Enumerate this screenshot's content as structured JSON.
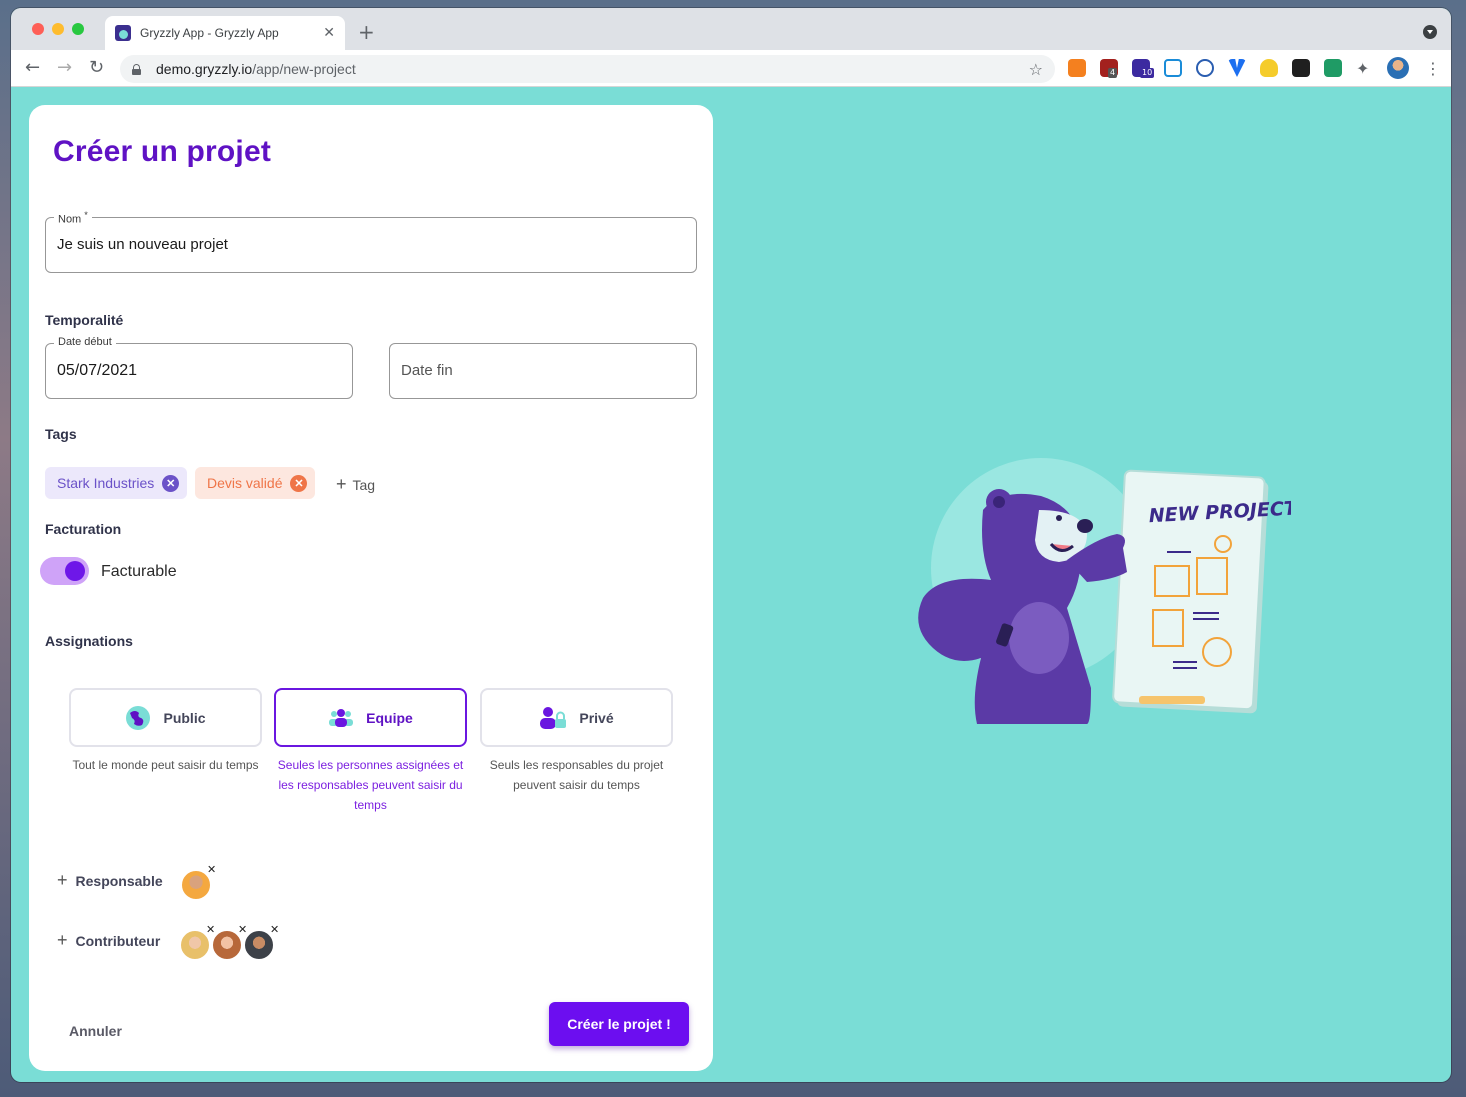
{
  "browser": {
    "tab_title": "Gryzzly App - Gryzzly App",
    "url_host": "demo.gryzzly.io",
    "url_path": "/app/new-project",
    "extension_badges": [
      "4",
      "10"
    ]
  },
  "form": {
    "title": "Créer un projet",
    "name": {
      "label": "Nom",
      "required_mark": "*",
      "value": "Je suis un nouveau projet"
    },
    "temporality": {
      "heading": "Temporalité",
      "start": {
        "label": "Date début",
        "value": "05/07/2021"
      },
      "end": {
        "placeholder": "Date fin"
      }
    },
    "tags": {
      "heading": "Tags",
      "items": [
        {
          "label": "Stark Industries",
          "color": "#6b52c8"
        },
        {
          "label": "Devis validé",
          "color": "#ef7548"
        }
      ],
      "add_label": "Tag"
    },
    "billing": {
      "heading": "Facturation",
      "toggle_label": "Facturable",
      "enabled": true
    },
    "assignations": {
      "heading": "Assignations",
      "options": [
        {
          "label": "Public",
          "icon": "globe-icon",
          "description": "Tout le monde peut saisir du temps",
          "selected": false
        },
        {
          "label": "Equipe",
          "icon": "team-icon",
          "description": "Seules les personnes assignées et les responsables peuvent saisir du temps",
          "selected": true
        },
        {
          "label": "Privé",
          "icon": "lock-user-icon",
          "description": "Seuls les responsables du projet peuvent saisir du temps",
          "selected": false
        }
      ],
      "responsable_label": "Responsable",
      "contributeur_label": "Contributeur"
    },
    "cancel_label": "Annuler",
    "submit_label": "Créer le projet !"
  },
  "illustration": {
    "board_text": "NEW PROJECT"
  },
  "colors": {
    "brand": "#5f12c4",
    "accent": "#6c0ef0",
    "background": "#7addd6"
  }
}
